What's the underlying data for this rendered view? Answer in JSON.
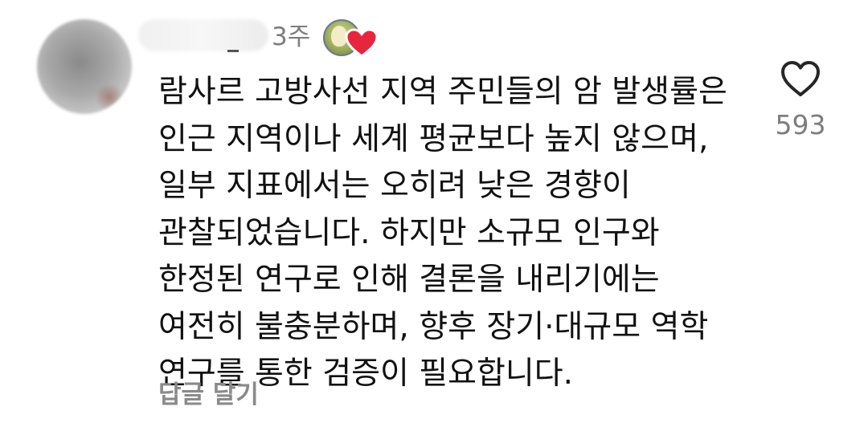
{
  "comment": {
    "timestamp": "3주",
    "text_lines": [
      "람사르 고방사선 지역 주민들의 암 발생률은",
      "인근 지역이나 세계 평균보다 높지 않으며,",
      "일부 지표에서는 오히려 낮은 경향이",
      "관찰되었습니다. 하지만 소규모 인구와",
      "한정된 연구로 인해 결론을 내리기에는",
      "여전히 불충분하며, 향후 장기·대규모 역학",
      "연구를 통한 검증이 필요합니다."
    ],
    "reply_label": "답글 달기",
    "like_count": "593",
    "icons": {
      "like": "heart-outline-icon",
      "badge": "profile-badge-with-heart-icon"
    },
    "colors": {
      "text": "#111111",
      "meta": "#7d7d7d",
      "reply": "#8a8a8a",
      "heart_badge": "#e8253f",
      "like_outline": "#262626"
    }
  }
}
